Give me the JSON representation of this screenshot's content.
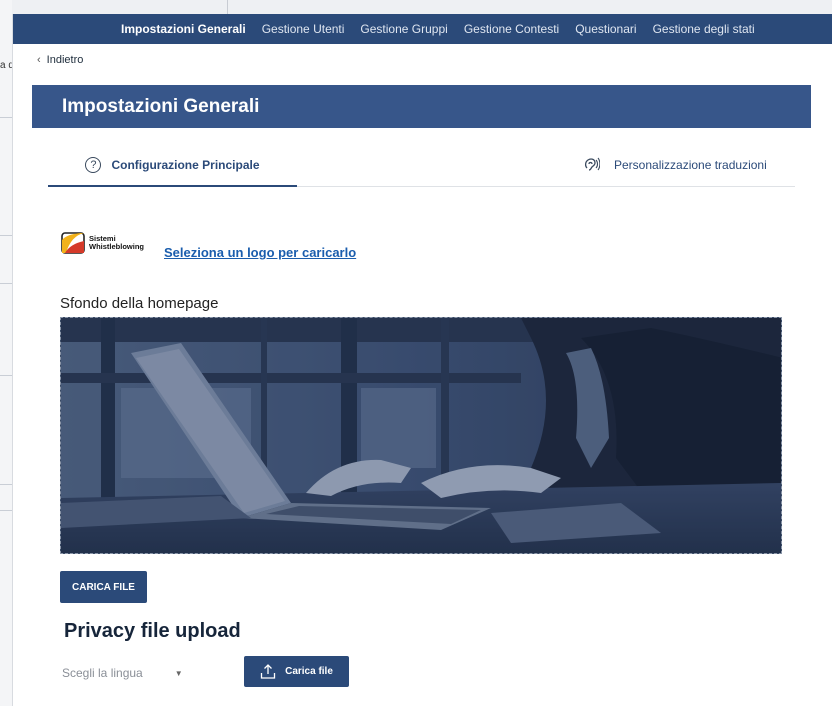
{
  "background": {
    "fragment_text": "a d"
  },
  "nav": {
    "items": [
      {
        "label": "Impostazioni Generali",
        "active": true
      },
      {
        "label": "Gestione Utenti",
        "active": false
      },
      {
        "label": "Gestione Gruppi",
        "active": false
      },
      {
        "label": "Gestione Contesti",
        "active": false
      },
      {
        "label": "Questionari",
        "active": false
      },
      {
        "label": "Gestione degli stati",
        "active": false
      }
    ]
  },
  "back": {
    "label": "Indietro",
    "icon": "chevron-left-icon"
  },
  "page": {
    "title": "Impostazioni Generali"
  },
  "tabs": {
    "main": {
      "label": "Configurazione Principale",
      "icon": "question-circle-icon",
      "selected": true
    },
    "translations": {
      "label": "Personalizzazione traduzioni",
      "icon": "ear-icon",
      "selected": false
    }
  },
  "logo": {
    "line1": "Sistemi",
    "line2": "Whistleblowing",
    "link_label": "Seleziona un logo per caricarlo"
  },
  "homepage_bg": {
    "label": "Sfondo della homepage",
    "upload_button": "CARICA FILE"
  },
  "privacy": {
    "title": "Privacy file upload",
    "language_placeholder": "Scegli la lingua",
    "upload_button": "Carica file",
    "upload_icon": "upload-icon"
  },
  "colors": {
    "nav_bg": "#2b4a79",
    "header_bg": "#37568a",
    "accent": "#2b4a79",
    "link": "#1a5dad"
  }
}
